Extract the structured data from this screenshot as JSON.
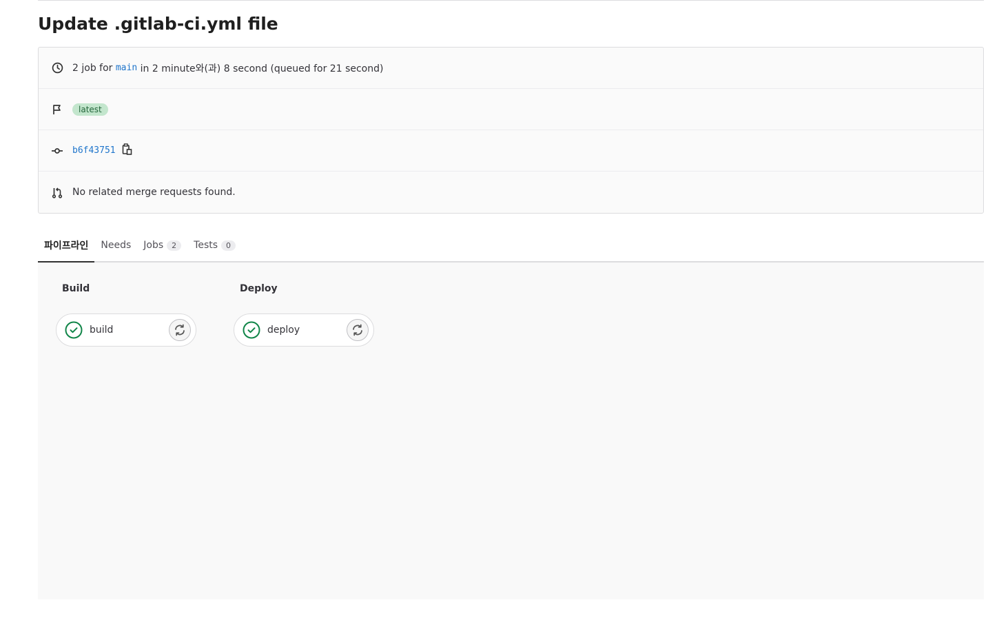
{
  "page": {
    "title": "Update .gitlab-ci.yml file"
  },
  "info": {
    "jobs_prefix": "2 job for",
    "branch": "main",
    "duration_text": "in 2 minute와(과) 8 second (queued for 21 second)",
    "badge": "latest",
    "commit_sha": "b6f43751",
    "merge_requests": "No related merge requests found."
  },
  "tabs": [
    {
      "label": "파이프라인",
      "count": null,
      "active": true
    },
    {
      "label": "Needs",
      "count": null,
      "active": false
    },
    {
      "label": "Jobs",
      "count": "2",
      "active": false
    },
    {
      "label": "Tests",
      "count": "0",
      "active": false
    }
  ],
  "stages": [
    {
      "title": "Build",
      "job": {
        "name": "build",
        "status": "passed"
      }
    },
    {
      "title": "Deploy",
      "job": {
        "name": "deploy",
        "status": "passed"
      }
    }
  ],
  "colors": {
    "success": "#108548",
    "link": "#1f75cb",
    "badge_bg": "#c3e6cd"
  },
  "icons": {
    "duration": "clock-icon",
    "badge": "flag-icon",
    "commit": "commit-icon",
    "copy": "clipboard-icon",
    "merge_request": "merge-request-icon",
    "job_status": "check-circle-icon",
    "job_action": "retry-icon"
  }
}
